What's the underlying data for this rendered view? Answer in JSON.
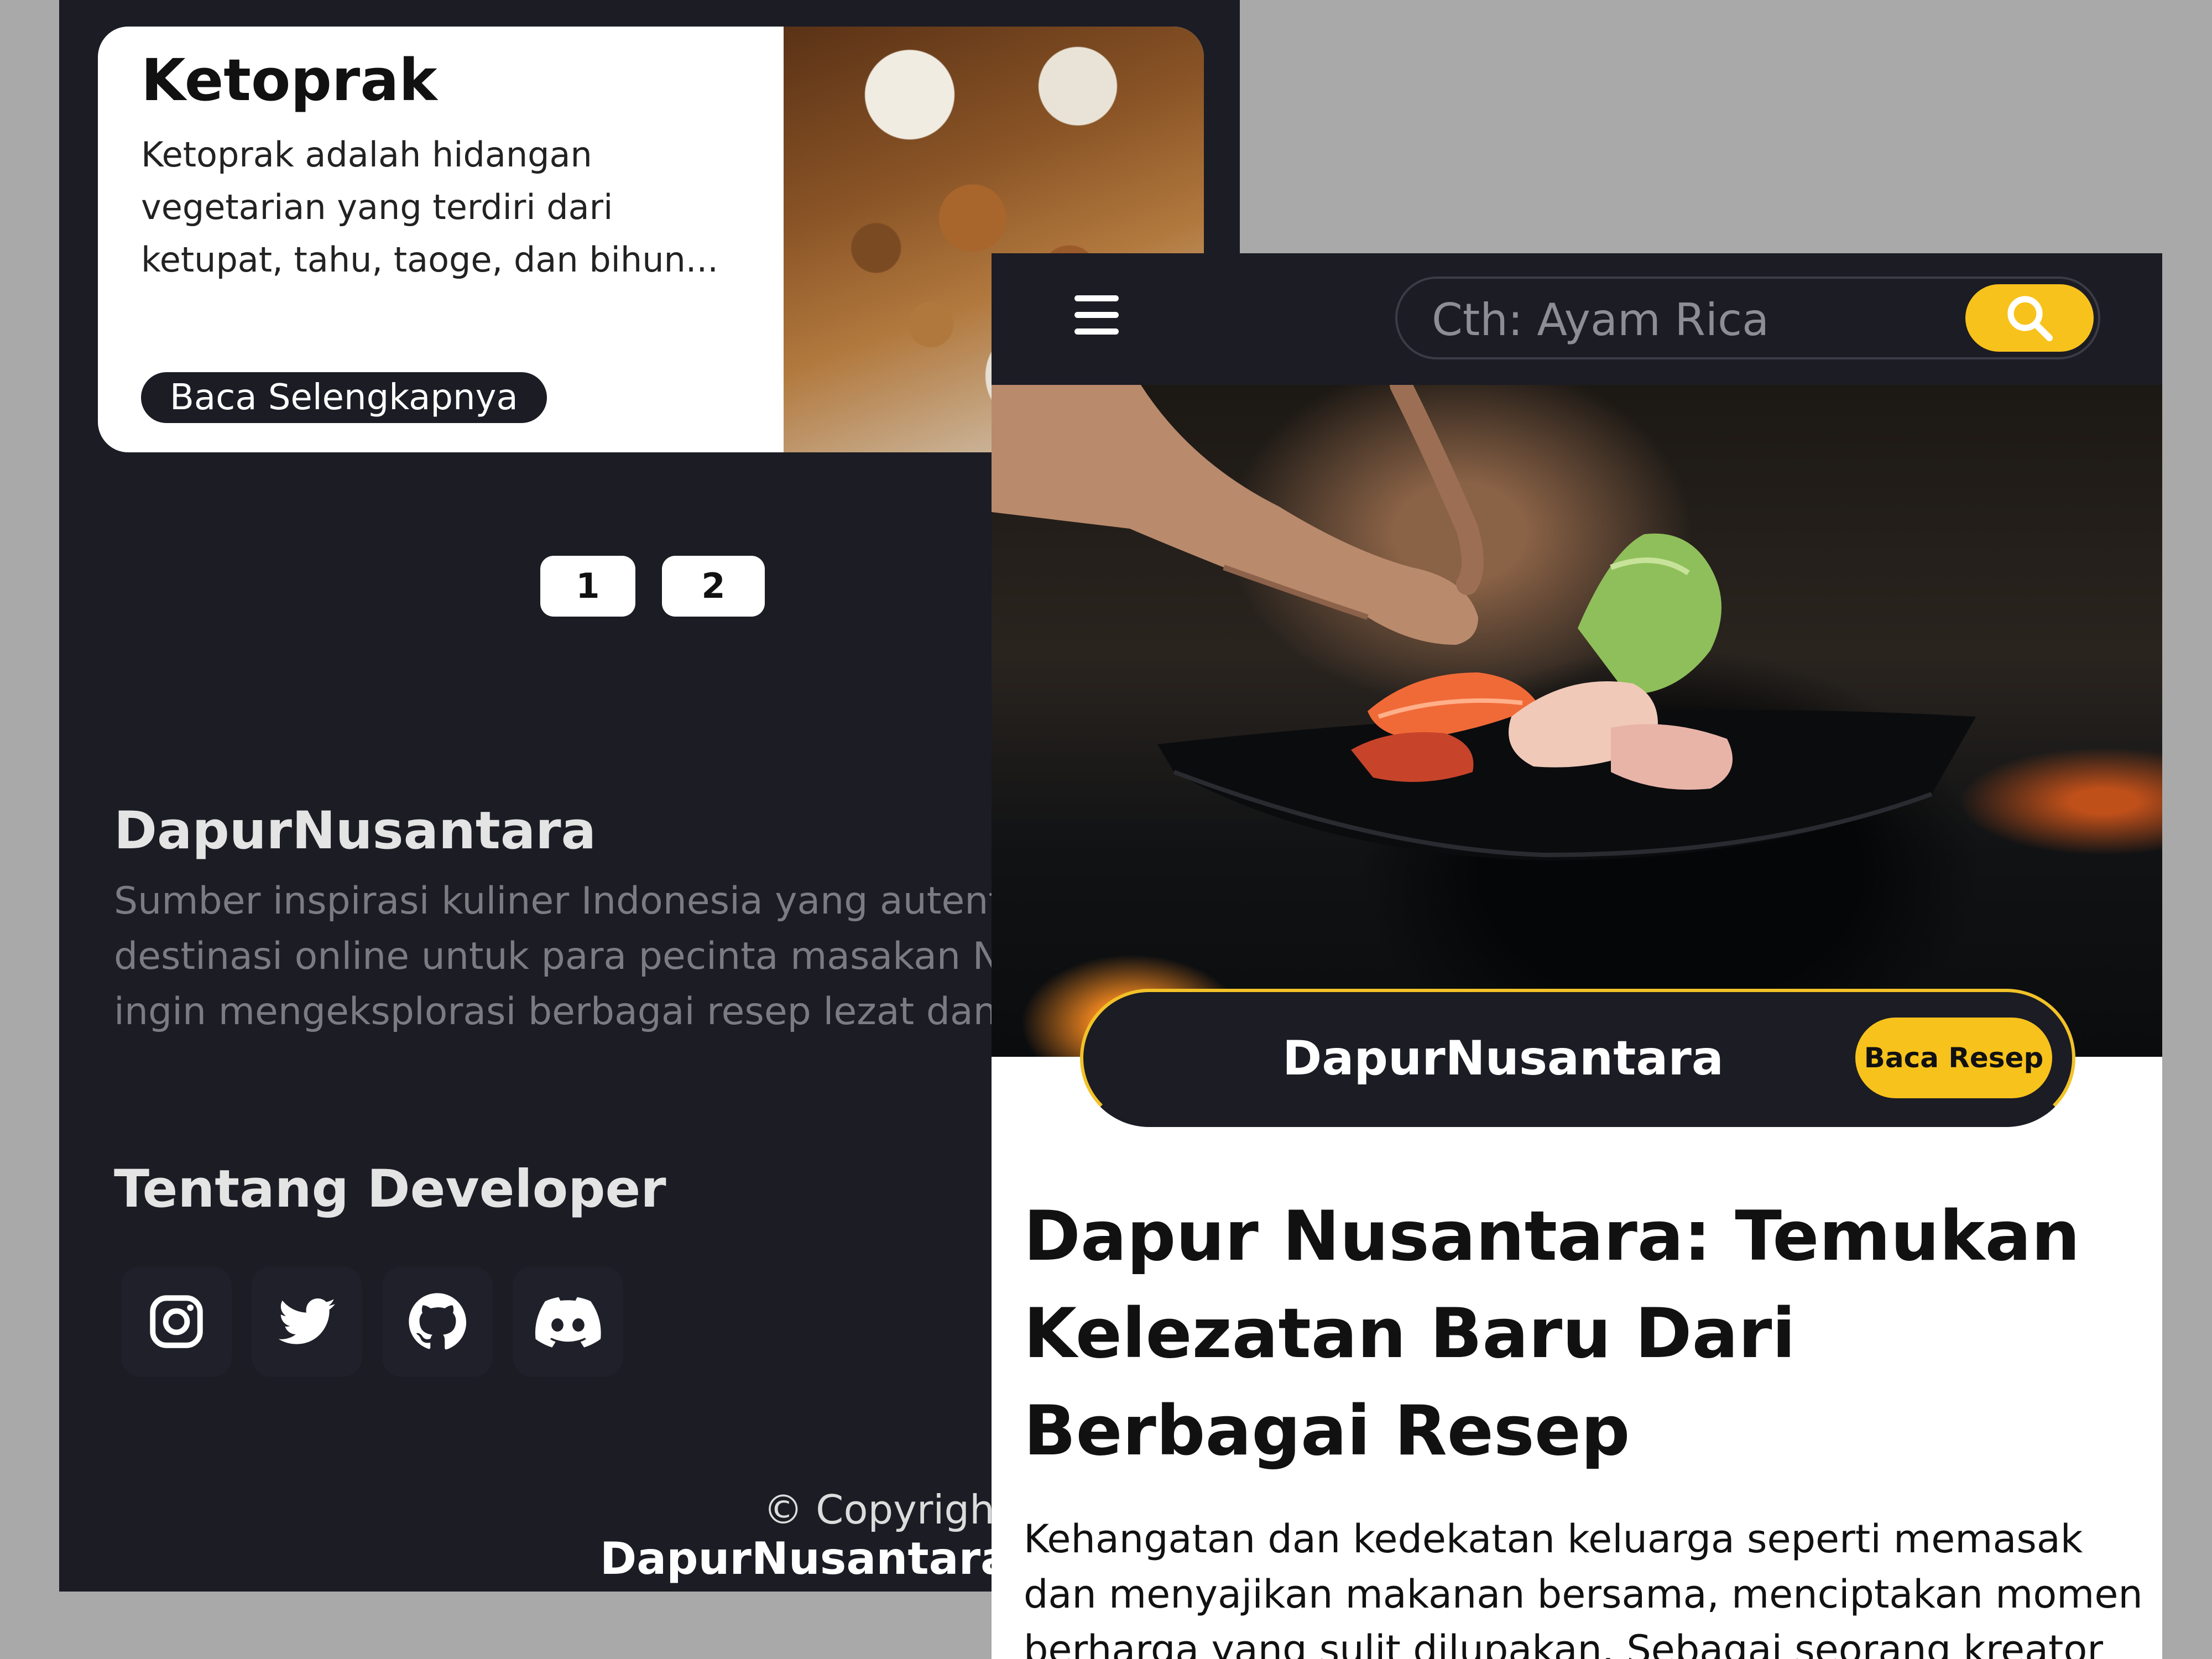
{
  "back_screen": {
    "card": {
      "title": "Ketoprak",
      "description": "Ketoprak adalah hidangan vegetarian yang terdiri dari ketupat, tahu, taoge, dan bihun...",
      "button_label": "Baca Selengkapnya",
      "image": "ketoprak-photo"
    },
    "pagination": [
      "1",
      "2"
    ],
    "footer": {
      "brand_title": "DapurNusantara",
      "brand_description": "Sumber inspirasi kuliner Indonesia yang autentik adalah destinasi online untuk para pecinta masakan Nusantara yang ingin mengeksplorasi berbagai resep lezat dan tradisional.",
      "developer_title": "Tentang Developer",
      "social_icons": [
        "instagram-icon",
        "twitter-icon",
        "github-icon",
        "discord-icon"
      ],
      "copyright_prefix": "© Copyright",
      "copyright_brand": "DapurNusantara"
    }
  },
  "front_screen": {
    "header": {
      "menu_icon": "hamburger-menu-icon",
      "search_placeholder": "Cth: Ayam Rica",
      "search_icon": "search-icon"
    },
    "hero": {
      "image": "chef-plating-sashimi-photo",
      "brand": "DapurNusantara",
      "button_label": "Baca Resep"
    },
    "article": {
      "title": "Dapur Nusantara: Temukan Kelezatan Baru Dari Berbagai Resep",
      "body": "Kehangatan dan kedekatan keluarga seperti memasak dan menyajikan makanan bersama, menciptakan momen berharga yang sulit dilupakan. Sebagai seorang kreator"
    }
  },
  "colors": {
    "dark": "#1b1c24",
    "accent": "#f8c21c",
    "background": "#a9a9a9",
    "card": "#ffffff"
  }
}
